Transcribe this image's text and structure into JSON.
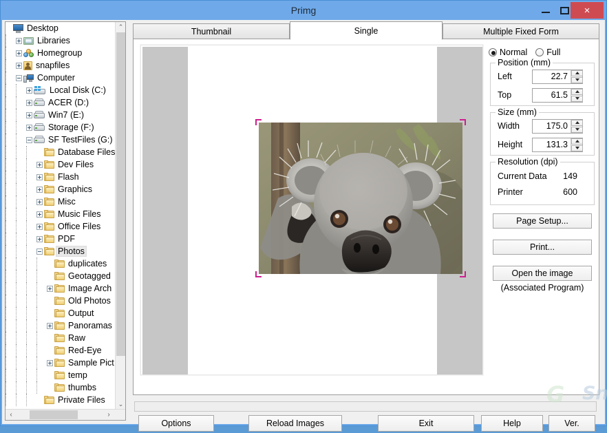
{
  "window": {
    "title": "Primg",
    "controls": {
      "minimize": "minimize-button",
      "maximize": "maximize-button",
      "close": "×"
    }
  },
  "tree": {
    "items": [
      {
        "label": "Desktop",
        "depth": 0,
        "icon": "desktop-icon",
        "expander": "none",
        "selected": false
      },
      {
        "label": "Libraries",
        "depth": 1,
        "icon": "libraries-icon",
        "expander": "plus",
        "selected": false
      },
      {
        "label": "Homegroup",
        "depth": 1,
        "icon": "homegroup-icon",
        "expander": "plus",
        "selected": false
      },
      {
        "label": "snapfiles",
        "depth": 1,
        "icon": "user-icon",
        "expander": "plus",
        "selected": false
      },
      {
        "label": "Computer",
        "depth": 1,
        "icon": "computer-icon",
        "expander": "minus",
        "selected": false
      },
      {
        "label": "Local Disk (C:)",
        "depth": 2,
        "icon": "local-disk-icon",
        "expander": "plus",
        "selected": false
      },
      {
        "label": "ACER (D:)",
        "depth": 2,
        "icon": "drive-icon",
        "expander": "plus",
        "selected": false
      },
      {
        "label": "Win7 (E:)",
        "depth": 2,
        "icon": "drive-icon",
        "expander": "plus",
        "selected": false
      },
      {
        "label": "Storage (F:)",
        "depth": 2,
        "icon": "drive-icon",
        "expander": "plus",
        "selected": false
      },
      {
        "label": "SF TestFiles (G:)",
        "depth": 2,
        "icon": "drive-icon",
        "expander": "minus",
        "selected": false
      },
      {
        "label": "Database Files",
        "depth": 3,
        "icon": "folder-icon",
        "expander": "none",
        "selected": false
      },
      {
        "label": "Dev Files",
        "depth": 3,
        "icon": "folder-icon",
        "expander": "plus",
        "selected": false
      },
      {
        "label": "Flash",
        "depth": 3,
        "icon": "folder-icon",
        "expander": "plus",
        "selected": false
      },
      {
        "label": "Graphics",
        "depth": 3,
        "icon": "folder-icon",
        "expander": "plus",
        "selected": false
      },
      {
        "label": "Misc",
        "depth": 3,
        "icon": "folder-icon",
        "expander": "plus",
        "selected": false
      },
      {
        "label": "Music Files",
        "depth": 3,
        "icon": "folder-icon",
        "expander": "plus",
        "selected": false
      },
      {
        "label": "Office Files",
        "depth": 3,
        "icon": "folder-icon",
        "expander": "plus",
        "selected": false
      },
      {
        "label": "PDF",
        "depth": 3,
        "icon": "folder-icon",
        "expander": "plus",
        "selected": false
      },
      {
        "label": "Photos",
        "depth": 3,
        "icon": "folder-icon",
        "expander": "minus",
        "selected": true
      },
      {
        "label": "duplicates",
        "depth": 4,
        "icon": "folder-icon",
        "expander": "none",
        "selected": false
      },
      {
        "label": "Geotagged",
        "depth": 4,
        "icon": "folder-icon",
        "expander": "none",
        "selected": false
      },
      {
        "label": "Image Arch",
        "depth": 4,
        "icon": "folder-icon",
        "expander": "plus",
        "selected": false
      },
      {
        "label": "Old Photos",
        "depth": 4,
        "icon": "folder-icon",
        "expander": "none",
        "selected": false
      },
      {
        "label": "Output",
        "depth": 4,
        "icon": "folder-icon",
        "expander": "none",
        "selected": false
      },
      {
        "label": "Panoramas",
        "depth": 4,
        "icon": "folder-icon",
        "expander": "plus",
        "selected": false
      },
      {
        "label": "Raw",
        "depth": 4,
        "icon": "folder-icon",
        "expander": "none",
        "selected": false
      },
      {
        "label": "Red-Eye",
        "depth": 4,
        "icon": "folder-icon",
        "expander": "none",
        "selected": false
      },
      {
        "label": "Sample Pict",
        "depth": 4,
        "icon": "folder-icon",
        "expander": "plus",
        "selected": false
      },
      {
        "label": "temp",
        "depth": 4,
        "icon": "folder-icon",
        "expander": "none",
        "selected": false
      },
      {
        "label": "thumbs",
        "depth": 4,
        "icon": "folder-icon",
        "expander": "none",
        "selected": false
      },
      {
        "label": "Private Files",
        "depth": 3,
        "icon": "folder-icon",
        "expander": "none",
        "selected": false
      }
    ],
    "scrollbar": {
      "up_arrow": "⌃",
      "down_arrow": "⌄",
      "left_arrow": "‹",
      "right_arrow": "›"
    }
  },
  "tabs": [
    {
      "label": "Thumbnail",
      "active": false
    },
    {
      "label": "Single",
      "active": true
    },
    {
      "label": "Multiple Fixed Form",
      "active": false
    }
  ],
  "sidebar": {
    "mode": {
      "normal": "Normal",
      "full": "Full",
      "selected": "Normal"
    },
    "position": {
      "legend": "Position (mm)",
      "fields": [
        {
          "label": "Left",
          "value": "22.7"
        },
        {
          "label": "Top",
          "value": "61.5"
        }
      ]
    },
    "size": {
      "legend": "Size (mm)",
      "fields": [
        {
          "label": "Width",
          "value": "175.0"
        },
        {
          "label": "Height",
          "value": "131.3"
        }
      ]
    },
    "resolution": {
      "legend": "Resolution (dpi)",
      "rows": [
        {
          "label": "Current Data",
          "value": "149"
        },
        {
          "label": "Printer",
          "value": "600"
        }
      ]
    },
    "buttons": {
      "page_setup": "Page Setup...",
      "print": "Print...",
      "open_image": "Open the image"
    },
    "assoc_note": "(Associated Program)"
  },
  "bottom_buttons": [
    {
      "label": "Options"
    },
    {
      "label": "Reload Images"
    },
    {
      "label": "Exit"
    },
    {
      "label": "Help"
    },
    {
      "label": "Ver."
    }
  ],
  "watermark": {
    "mark": "G",
    "text": "SnapFiles"
  },
  "colors": {
    "titlebar": "#6fa9e9",
    "close_button": "#cf4b52",
    "handle": "#cc1f8d",
    "page_margin": "#c6c6c6",
    "accent": "#5b9bd5"
  }
}
